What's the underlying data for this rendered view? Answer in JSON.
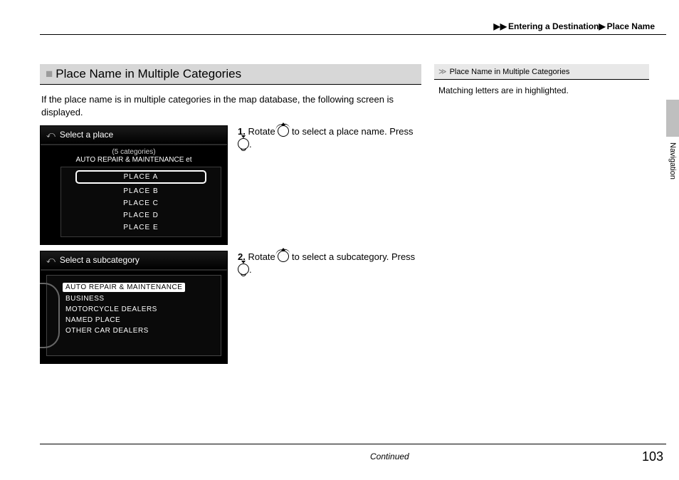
{
  "breadcrumb": {
    "sep": "▶▶",
    "a": "Entering a Destination",
    "s2": "▶",
    "b": "Place Name"
  },
  "section": {
    "title": "Place Name in Multiple Categories"
  },
  "intro": "If the place name is in multiple categories in the map database, the following screen is displayed.",
  "screen1": {
    "title": "Select a place",
    "subtitle": "(5 categories)",
    "category": "AUTO REPAIR & MAINTENANCE et",
    "items": [
      "PLACE A",
      "PLACE B",
      "PLACE C",
      "PLACE D",
      "PLACE E"
    ]
  },
  "screen2": {
    "title": "Select a subcategory",
    "items": [
      "AUTO REPAIR & MAINTENANCE",
      "BUSINESS",
      "MOTORCYCLE DEALERS",
      "NAMED PLACE",
      "OTHER CAR DEALERS"
    ]
  },
  "step1": {
    "n": "1.",
    "a": "Rotate ",
    "b": " to select a place name. Press ",
    "c": "."
  },
  "step2": {
    "n": "2.",
    "a": "Rotate ",
    "b": " to select a subcategory. Press ",
    "c": "."
  },
  "side": {
    "title": "Place Name in Multiple Categories",
    "body": "Matching letters are in highlighted."
  },
  "tab": "Navigation",
  "continued": "Continued",
  "page": "103"
}
